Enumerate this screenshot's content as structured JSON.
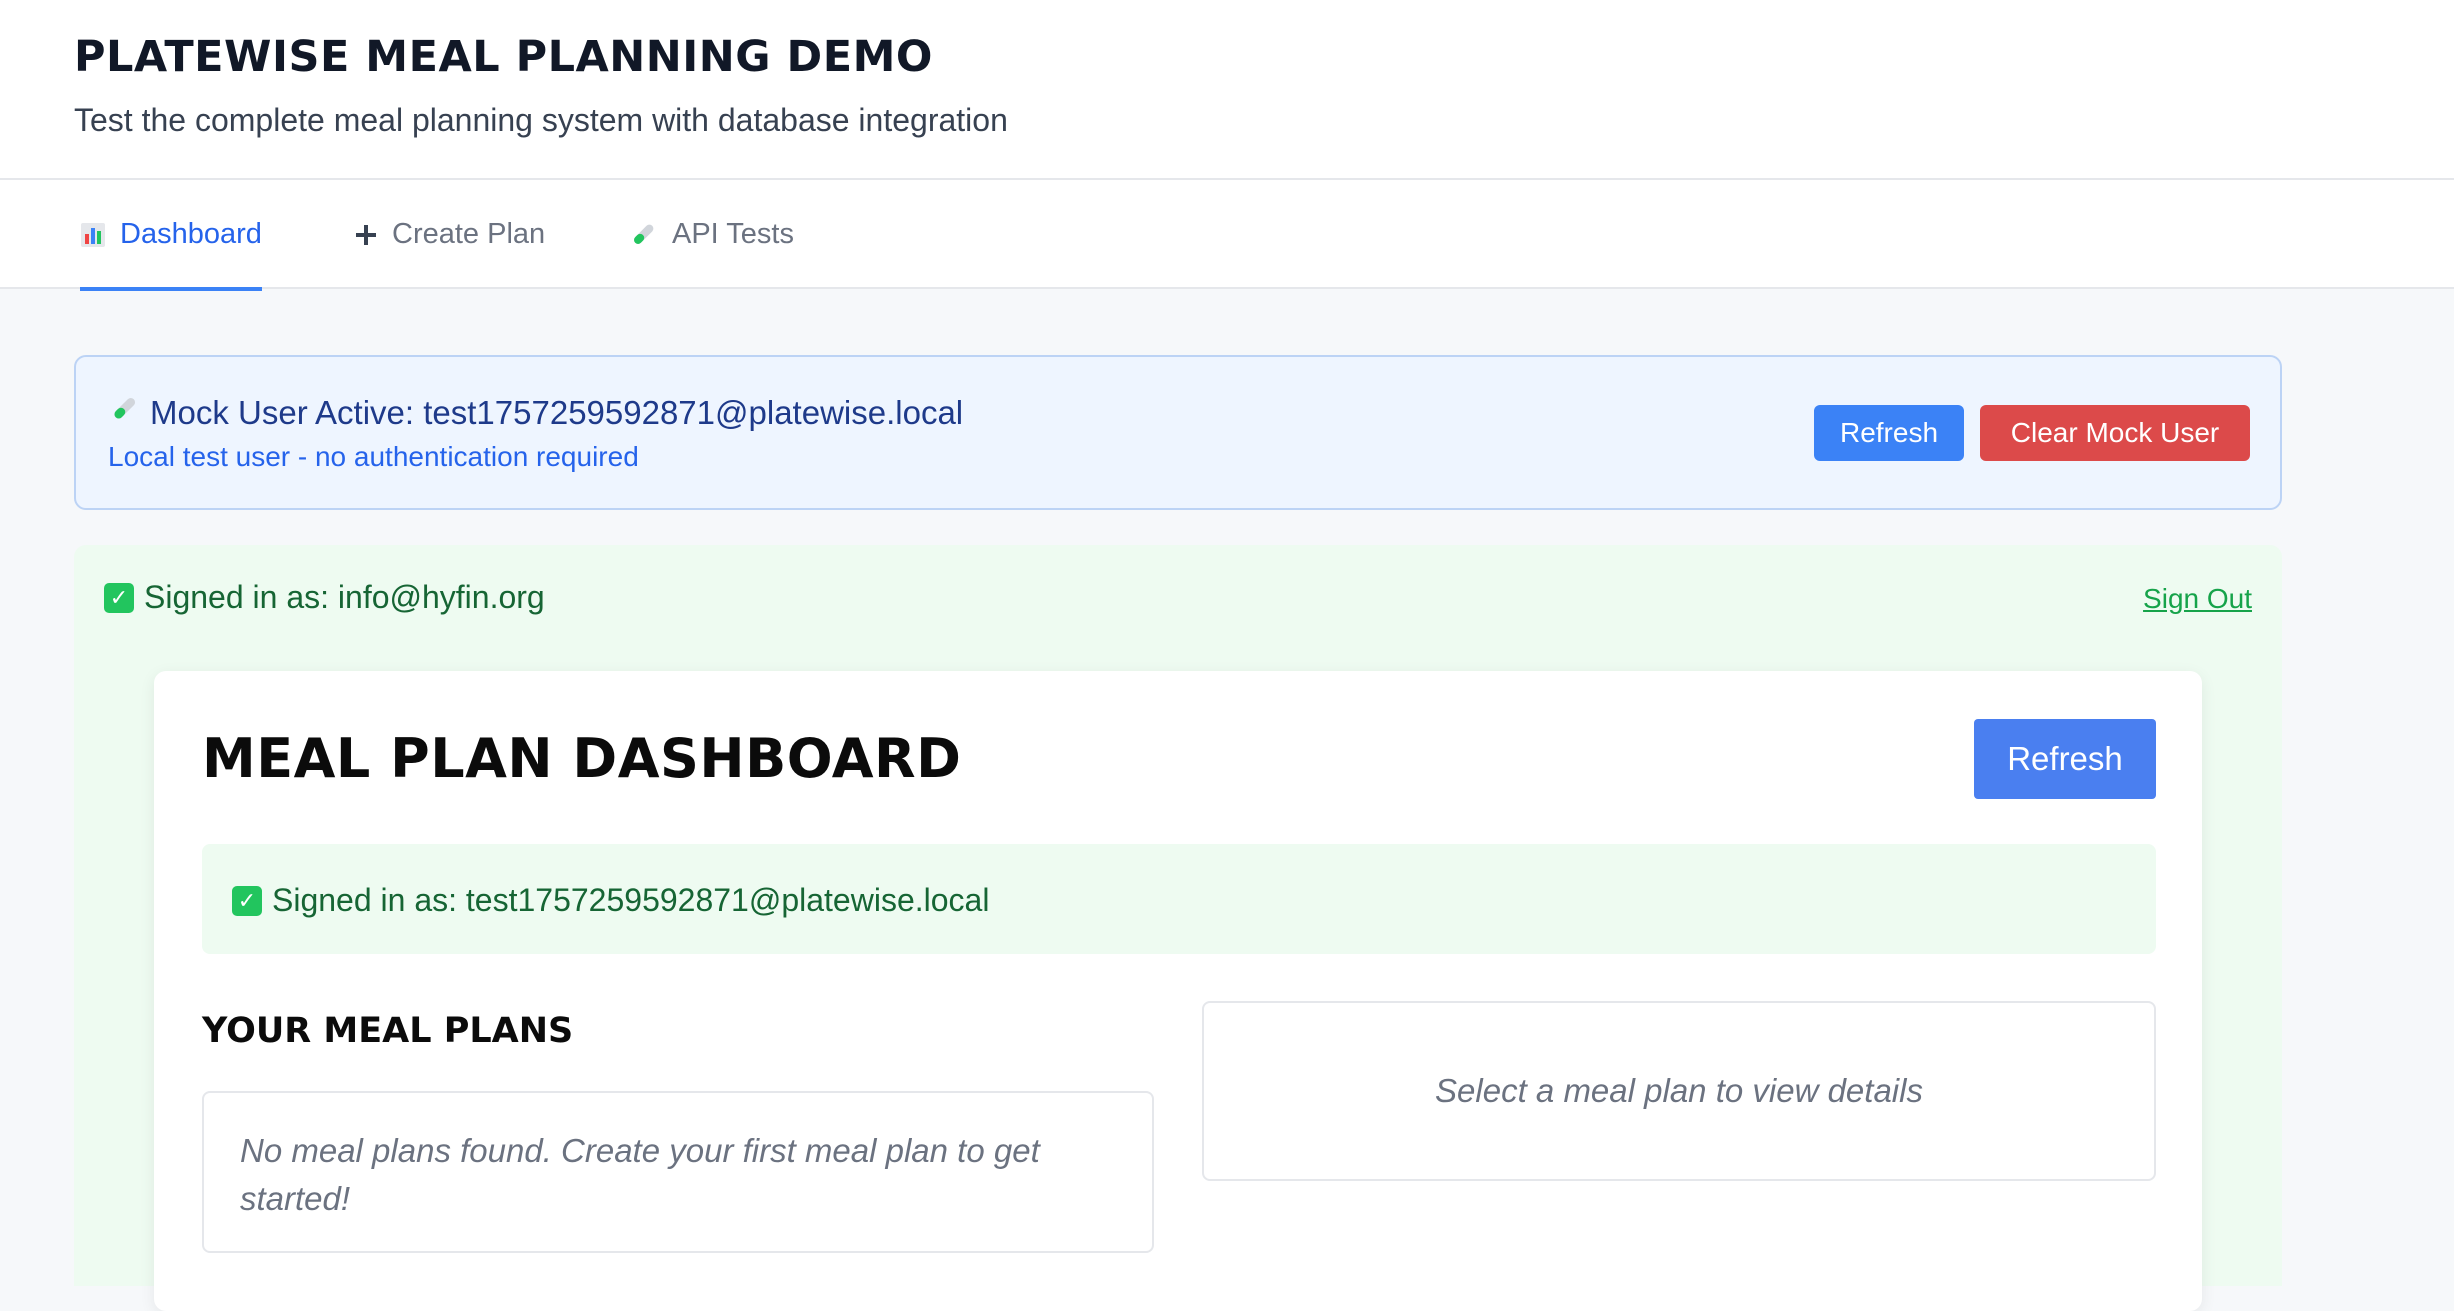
{
  "header": {
    "title": "PLATEWISE MEAL PLANNING DEMO",
    "subtitle": "Test the complete meal planning system with database integration"
  },
  "tabs": [
    {
      "label": "Dashboard",
      "icon": "bar-chart-icon",
      "active": true
    },
    {
      "label": "Create Plan",
      "icon": "plus-icon",
      "active": false
    },
    {
      "label": "API Tests",
      "icon": "test-tube-icon",
      "active": false
    }
  ],
  "mock_banner": {
    "title": "Mock User Active: test1757259592871@platewise.local",
    "subtitle": "Local test user - no authentication required",
    "refresh_label": "Refresh",
    "clear_label": "Clear Mock User"
  },
  "auth": {
    "signed_in_text": "Signed in as: info@hyfin.org",
    "sign_out_label": "Sign Out"
  },
  "dashboard": {
    "title": "MEAL PLAN DASHBOARD",
    "refresh_label": "Refresh",
    "signed_in_text": "Signed in as: test1757259592871@platewise.local",
    "plans_heading": "YOUR MEAL PLANS",
    "empty_message": "No meal plans found. Create your first meal plan to get started!",
    "details_placeholder": "Select a meal plan to view details"
  },
  "colors": {
    "accent": "#3b82f6",
    "danger": "#dc4a4a",
    "success": "#166534"
  }
}
